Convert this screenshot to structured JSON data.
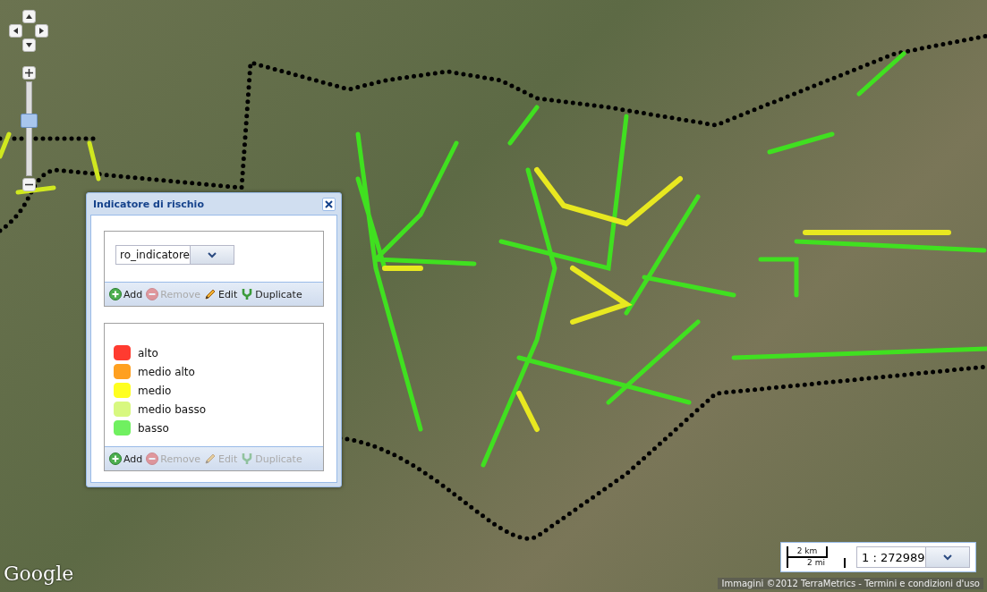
{
  "map": {
    "logo": "Google",
    "attribution": "Immagini ©2012 TerraMetrics - Termini e condizioni d'uso"
  },
  "zoom_slider": {
    "level": 0.6
  },
  "panel": {
    "title": "Indicatore di rischio",
    "layer_select": {
      "value": "ro_indicatore"
    },
    "layer_toolbar": [
      {
        "kind": "add",
        "label": "Add",
        "disabled": false
      },
      {
        "kind": "remove",
        "label": "Remove",
        "disabled": true
      },
      {
        "kind": "edit",
        "label": "Edit",
        "disabled": false
      },
      {
        "kind": "duplicate",
        "label": "Duplicate",
        "disabled": false
      }
    ],
    "legend": [
      {
        "label": "alto",
        "color": "#ff3b30"
      },
      {
        "label": "medio alto",
        "color": "#ffa020"
      },
      {
        "label": "medio",
        "color": "#ffff20"
      },
      {
        "label": "medio basso",
        "color": "#d8f880"
      },
      {
        "label": "basso",
        "color": "#70f060"
      }
    ],
    "legend_toolbar": [
      {
        "kind": "add",
        "label": "Add",
        "disabled": false
      },
      {
        "kind": "remove",
        "label": "Remove",
        "disabled": true
      },
      {
        "kind": "edit",
        "label": "Edit",
        "disabled": true
      },
      {
        "kind": "duplicate",
        "label": "Duplicate",
        "disabled": true
      }
    ]
  },
  "scale": {
    "km": "2 km",
    "mi": "2 mi",
    "scale_select": {
      "value": "1 : 272989"
    }
  }
}
